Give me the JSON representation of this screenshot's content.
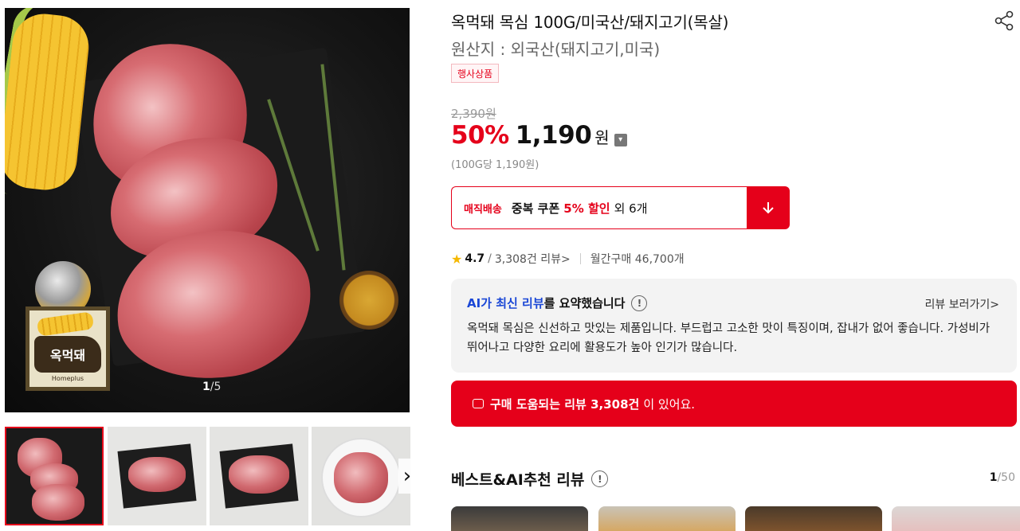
{
  "gallery": {
    "counter_current": "1",
    "counter_total": "/5",
    "brand_badge_label": "옥먹돼",
    "brand_badge_maker": "Homeplus"
  },
  "product": {
    "title": "옥먹돼 목심 100G/미국산/돼지고기(목살)",
    "origin": "원산지 : 외국산(돼지고기,미국)",
    "event_badge": "행사상품",
    "original_price": "2,390원",
    "discount": "50%",
    "price": "1,190",
    "currency": "원",
    "unit_price": "(100G당 1,190원)"
  },
  "coupon": {
    "tag": "매직배송",
    "main": "중복 쿠폰",
    "highlight": "5% 할인",
    "extra": "외 6개"
  },
  "rating": {
    "score": "4.7",
    "separator": "/",
    "review_count": "3,308건 리뷰>",
    "monthly_purchases": "월간구매 46,700개"
  },
  "ai_summary": {
    "heading_blue": "AI가 최신 리뷰",
    "heading_black": "를 요약했습니다",
    "info_glyph": "!",
    "more_link": "리뷰 보러가기>",
    "text": "옥먹돼 목심은 신선하고 맛있는 제품입니다. 부드럽고 고소한 맛이 특징이며, 잡내가 없어 좋습니다. 가성비가 뛰어나고 다양한 요리에 활용도가 높아 인기가 많습니다."
  },
  "review_banner": {
    "bold": "구매 도움되는 리뷰 3,308건",
    "rest": "이 있어요."
  },
  "best_reviews": {
    "heading": "베스트&AI추천 리뷰",
    "info_glyph": "!",
    "page_current": "1",
    "page_total": "/50"
  },
  "colors": {
    "accent": "#e5001a",
    "ai_blue": "#1a47d6",
    "star": "#f5b800"
  },
  "icons": {
    "share": "share-icon",
    "down_arrow": "arrow-down-icon",
    "next": "chevron-right-icon",
    "star": "star-icon",
    "chat": "chat-icon"
  }
}
